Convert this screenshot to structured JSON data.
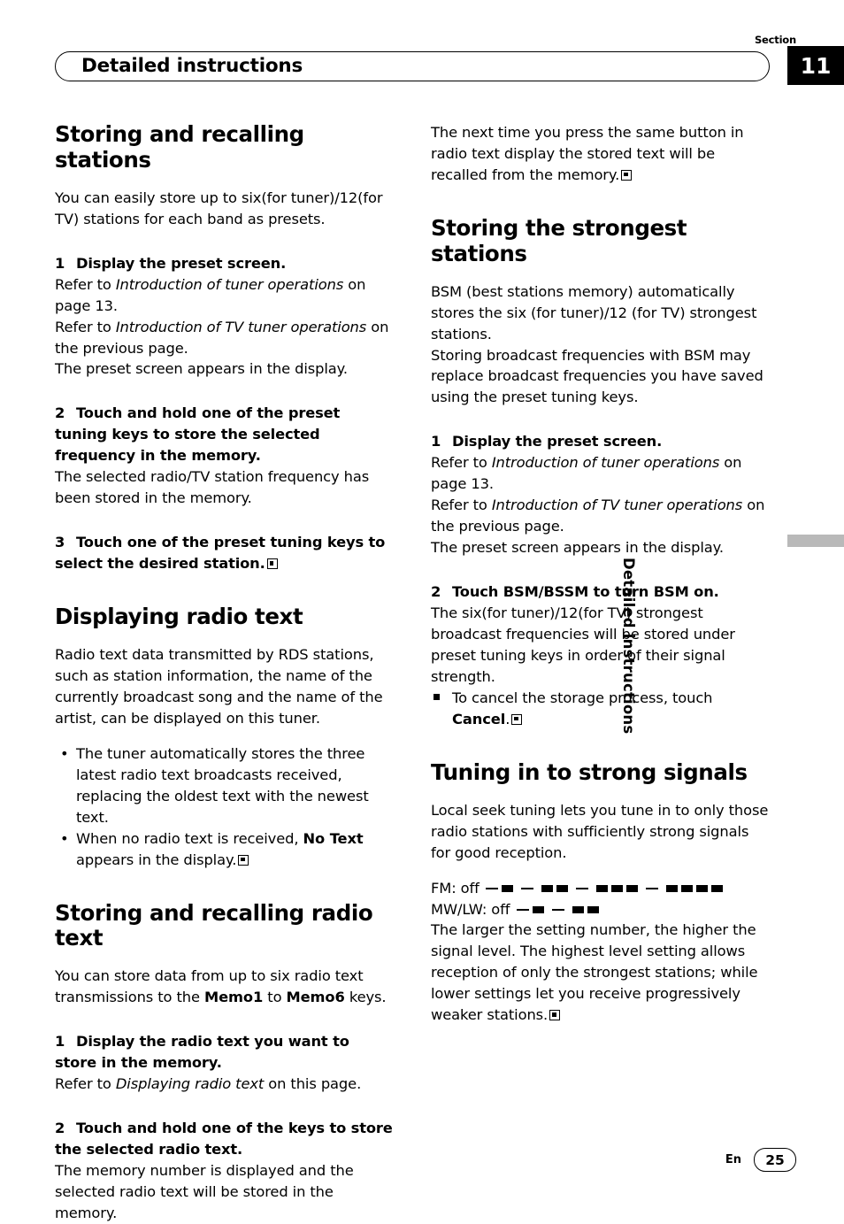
{
  "header": {
    "section_word": "Section",
    "section_number": "11",
    "title": "Detailed instructions",
    "side_tab_text": "Detailed instructions"
  },
  "footer": {
    "language": "En",
    "page_number": "25"
  },
  "left_column": {
    "h1_storing_recalling": "Storing and recalling stations",
    "intro": "You can easily store up to six(for tuner)/12(for TV) stations for each band as presets.",
    "step1_num": "1",
    "step1_title": "Display the preset screen.",
    "step1_line1_pre": "Refer to ",
    "step1_line1_ital": "Introduction of tuner operations",
    "step1_line1_post": " on page 13.",
    "step1_line2_pre": "Refer to ",
    "step1_line2_ital": "Introduction of TV tuner operations",
    "step1_line2_post": " on the previous page.",
    "step1_line3": "The preset screen appears in the display.",
    "step2_num": "2",
    "step2_title": "Touch and hold one of the preset tuning keys to store the selected frequency in the memory.",
    "step2_body": "The selected radio/TV station frequency has been stored in the memory.",
    "step3_num": "3",
    "step3_title": "Touch one of the preset tuning keys to select the desired station.",
    "h1_displaying_radio_text": "Displaying radio text",
    "radio_text_intro": "Radio text data transmitted by RDS stations, such as station information, the name of the currently broadcast song and the name of the artist, can be displayed on this tuner.",
    "bullet1": "The tuner automatically stores the three latest radio text broadcasts received, replacing the oldest text with the newest text.",
    "bullet2_pre": "When no radio text is received, ",
    "bullet2_bold": "No Text",
    "bullet2_post": " appears in the display.",
    "h1_storing_recalling_radio_text": "Storing and recalling radio text",
    "store_intro_pre": "You can store data from up to six radio text transmissions to the ",
    "store_intro_b1": "Memo1",
    "store_intro_mid": " to ",
    "store_intro_b2": "Memo6",
    "store_intro_post": " keys.",
    "s1_num": "1",
    "s1_title": "Display the radio text you want to store in the memory.",
    "s1_body_pre": "Refer to ",
    "s1_body_ital": "Displaying radio text",
    "s1_body_post": " on this page.",
    "s2_num": "2",
    "s2_title": "Touch and hold one of the keys to store the selected radio text.",
    "s2_body": "The memory number is displayed and the selected radio text will be stored in the memory."
  },
  "right_column": {
    "top_para": "The next time you press the same button in radio text display the stored text will be recalled from the memory.",
    "h1_storing_strongest": "Storing the strongest stations",
    "bsm_para1": "BSM (best stations memory) automatically stores the six (for tuner)/12 (for TV) strongest stations.",
    "bsm_para2": "Storing broadcast frequencies with BSM may replace broadcast frequencies you have saved using the preset tuning keys.",
    "step1_num": "1",
    "step1_title": "Display the preset screen.",
    "step1_line1_pre": "Refer to ",
    "step1_line1_ital": "Introduction of tuner operations",
    "step1_line1_post": " on page 13.",
    "step1_line2_pre": "Refer to ",
    "step1_line2_ital": "Introduction of TV tuner operations",
    "step1_line2_post": " on the previous page.",
    "step1_line3": "The preset screen appears in the display.",
    "step2_num": "2",
    "step2_title": "Touch BSM/BSSM to turn BSM on.",
    "step2_body": "The six(for tuner)/12(for TV) strongest broadcast frequencies will be stored under preset tuning keys in order of their signal strength.",
    "square_bullet_pre": "To cancel the storage process, touch ",
    "square_bullet_bold": "Cancel",
    "square_bullet_post": ".",
    "h1_tuning_strong": "Tuning in to strong signals",
    "local_para": "Local seek tuning lets you tune in to only those radio stations with sufficiently strong signals for good reception.",
    "fm_label": "FM: off",
    "mwlw_label": "MW/LW: off",
    "levels_para": "The larger the setting number, the higher the signal level. The highest level setting allows reception of only the strongest stations; while lower settings let you receive progressively weaker stations."
  }
}
